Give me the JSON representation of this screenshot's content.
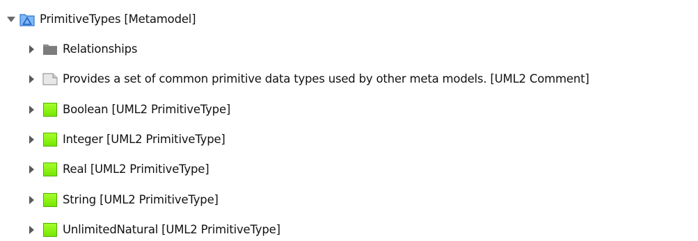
{
  "tree": {
    "root": {
      "label": "PrimitiveTypes [Metamodel]",
      "icon": "metamodel-icon",
      "expanded": true
    },
    "children": [
      {
        "label": "Relationships",
        "icon": "folder-icon"
      },
      {
        "label": "Provides a set of common primitive data types used by other meta models. [UML2 Comment]",
        "icon": "comment-icon"
      },
      {
        "label": "Boolean [UML2 PrimitiveType]",
        "icon": "primitive-type-icon"
      },
      {
        "label": "Integer [UML2 PrimitiveType]",
        "icon": "primitive-type-icon"
      },
      {
        "label": "Real [UML2 PrimitiveType]",
        "icon": "primitive-type-icon"
      },
      {
        "label": "String [UML2 PrimitiveType]",
        "icon": "primitive-type-icon"
      },
      {
        "label": "UnlimitedNatural [UML2 PrimitiveType]",
        "icon": "primitive-type-icon"
      }
    ]
  },
  "colors": {
    "primitive_type": "#8cf216",
    "folder": "#8f8f8f",
    "metamodel": "#3d8be8",
    "arrow": "#5a5a5a"
  }
}
